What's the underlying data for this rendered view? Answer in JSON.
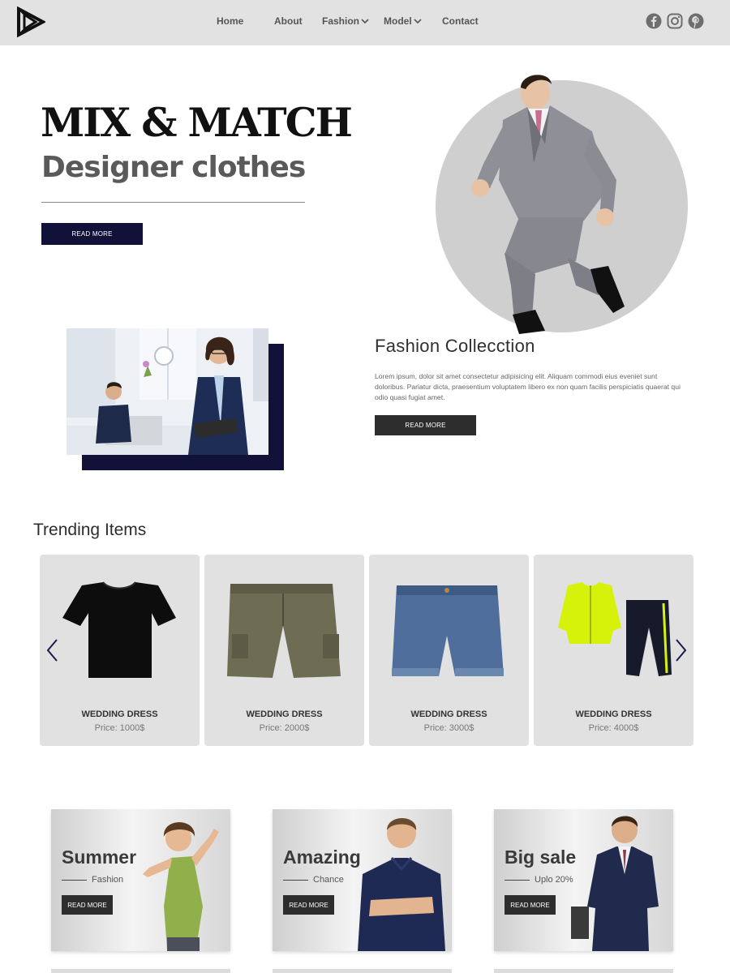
{
  "header": {
    "logo": "play-triangle-logo",
    "nav": [
      {
        "label": "Home",
        "dropdown": false
      },
      {
        "label": "About",
        "dropdown": false
      },
      {
        "label": "Fashion",
        "dropdown": true
      },
      {
        "label": "Model",
        "dropdown": true
      },
      {
        "label": "Contact",
        "dropdown": false
      }
    ],
    "social": [
      "facebook-icon",
      "instagram-icon",
      "pinterest-icon"
    ]
  },
  "hero": {
    "title": "MIX & MATCH",
    "subtitle": "Designer clothes",
    "button": "READ MORE"
  },
  "collection": {
    "title": "Fashion Collecction",
    "text": "Lorem ipsum, dolor sit amet consectetur adipisicing elit. Aliquam commodi eius eveniet sunt doloribus. Pariatur dicta, praesentium voluptatem libero ex non quam facilis perspiciatis quaerat qui odio quasi fugiat amet.",
    "button": "READ MORE"
  },
  "trending": {
    "title": "Trending Items",
    "items": [
      {
        "name": "WEDDING DRESS",
        "price": "Price: 1000$",
        "product": "black-tshirt"
      },
      {
        "name": "WEDDING DRESS",
        "price": "Price: 2000$",
        "product": "cargo-shorts"
      },
      {
        "name": "WEDDING DRESS",
        "price": "Price: 3000$",
        "product": "denim-shorts"
      },
      {
        "name": "WEDDING DRESS",
        "price": "Price: 4000$",
        "product": "tracksuit"
      }
    ]
  },
  "promos": [
    {
      "title": "Summer",
      "subtitle": "Fashion",
      "button": "READ MORE"
    },
    {
      "title": "Amazing",
      "subtitle": "Chance",
      "button": "READ MORE"
    },
    {
      "title": "Big sale",
      "subtitle": "Uplo 20%",
      "button": "READ MORE"
    }
  ],
  "colors": {
    "header_bg": "#e2e2e2",
    "navy": "#12113a",
    "dark_button": "#2d2d2d",
    "card_bg": "#e1e1e1",
    "accent_neon": "#d7f20a"
  }
}
